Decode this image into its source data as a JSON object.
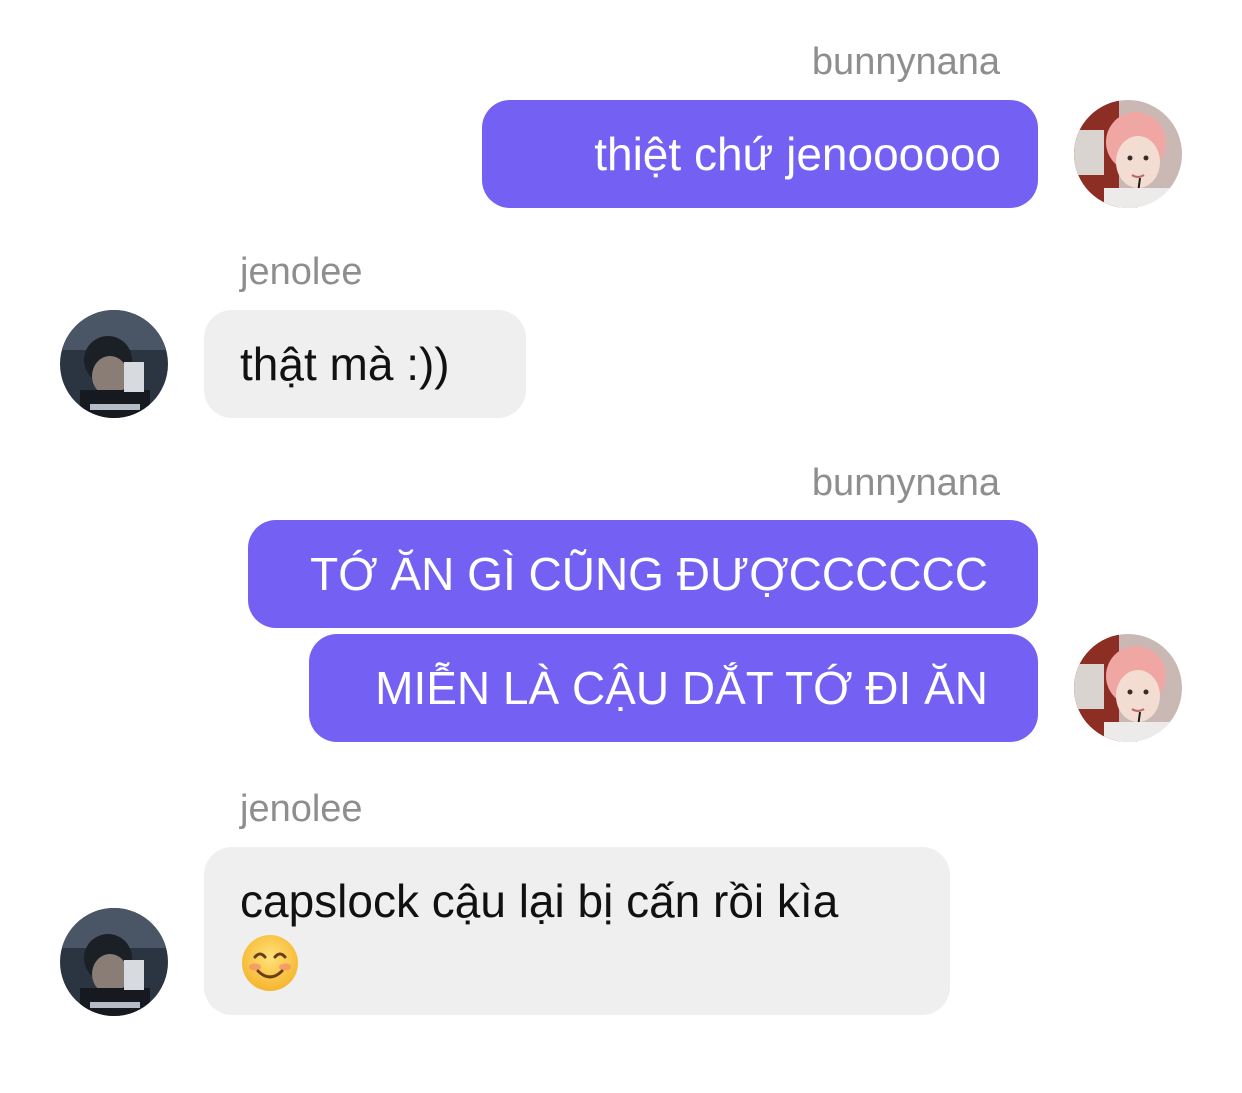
{
  "messages": [
    {
      "sender": "bunnynana",
      "direction": "outgoing",
      "lines": [
        "thiệt chứ jenoooooo"
      ]
    },
    {
      "sender": "jenolee",
      "direction": "incoming",
      "lines": [
        "thật mà :))"
      ]
    },
    {
      "sender": "bunnynana",
      "direction": "outgoing",
      "lines": [
        "TỚ ĂN GÌ CŨNG ĐƯỢCCCCCC",
        "MIỄN LÀ CẬU DẮT TỚ ĐI ĂN"
      ]
    },
    {
      "sender": "jenolee",
      "direction": "incoming",
      "lines": [
        "capslock cậu lại bị cấn rồi kìa"
      ],
      "emoji": "smiling-face-with-smiling-eyes"
    }
  ],
  "colors": {
    "outgoing_bubble": "#7560f4",
    "incoming_bubble": "#efefef",
    "sender_label": "#8e8e8e",
    "background": "#ffffff"
  }
}
